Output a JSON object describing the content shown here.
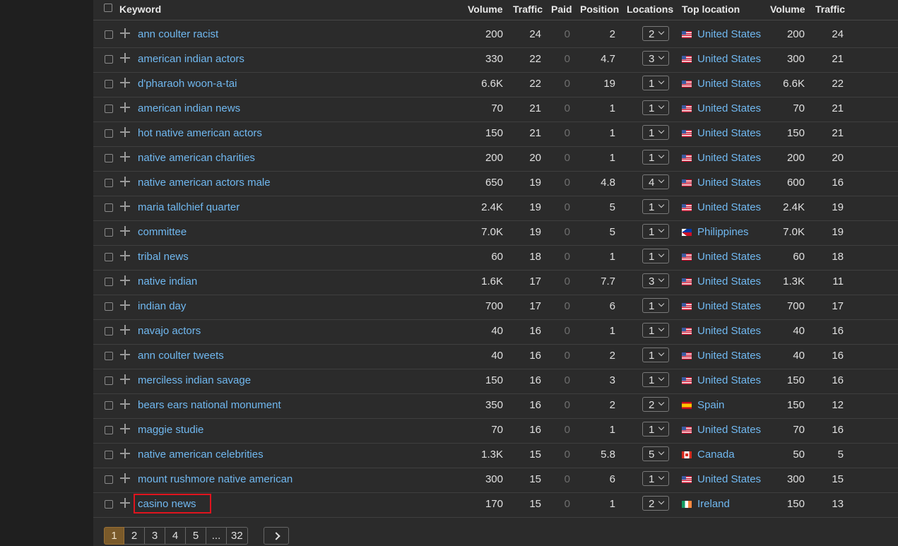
{
  "header": {
    "keyword": "Keyword",
    "volume": "Volume",
    "traffic": "Traffic",
    "paid": "Paid",
    "position": "Position",
    "locations": "Locations",
    "top_location": "Top location",
    "volume2": "Volume",
    "traffic2": "Traffic"
  },
  "rows": [
    {
      "keyword": "ann coulter racist",
      "volume": "200",
      "traffic": "24",
      "paid": "0",
      "position": "2",
      "locations": "2",
      "flag": "us",
      "country": "United States",
      "loc_volume": "200",
      "loc_traffic": "24"
    },
    {
      "keyword": "american indian actors",
      "volume": "330",
      "traffic": "22",
      "paid": "0",
      "position": "4.7",
      "locations": "3",
      "flag": "us",
      "country": "United States",
      "loc_volume": "300",
      "loc_traffic": "21"
    },
    {
      "keyword": "d'pharaoh woon-a-tai",
      "volume": "6.6K",
      "traffic": "22",
      "paid": "0",
      "position": "19",
      "locations": "1",
      "flag": "us",
      "country": "United States",
      "loc_volume": "6.6K",
      "loc_traffic": "22"
    },
    {
      "keyword": "american indian news",
      "volume": "70",
      "traffic": "21",
      "paid": "0",
      "position": "1",
      "locations": "1",
      "flag": "us",
      "country": "United States",
      "loc_volume": "70",
      "loc_traffic": "21"
    },
    {
      "keyword": "hot native american actors",
      "volume": "150",
      "traffic": "21",
      "paid": "0",
      "position": "1",
      "locations": "1",
      "flag": "us",
      "country": "United States",
      "loc_volume": "150",
      "loc_traffic": "21"
    },
    {
      "keyword": "native american charities",
      "volume": "200",
      "traffic": "20",
      "paid": "0",
      "position": "1",
      "locations": "1",
      "flag": "us",
      "country": "United States",
      "loc_volume": "200",
      "loc_traffic": "20"
    },
    {
      "keyword": "native american actors male",
      "volume": "650",
      "traffic": "19",
      "paid": "0",
      "position": "4.8",
      "locations": "4",
      "flag": "us",
      "country": "United States",
      "loc_volume": "600",
      "loc_traffic": "16"
    },
    {
      "keyword": "maria tallchief quarter",
      "volume": "2.4K",
      "traffic": "19",
      "paid": "0",
      "position": "5",
      "locations": "1",
      "flag": "us",
      "country": "United States",
      "loc_volume": "2.4K",
      "loc_traffic": "19"
    },
    {
      "keyword": "committee",
      "volume": "7.0K",
      "traffic": "19",
      "paid": "0",
      "position": "5",
      "locations": "1",
      "flag": "ph",
      "country": "Philippines",
      "loc_volume": "7.0K",
      "loc_traffic": "19"
    },
    {
      "keyword": "tribal news",
      "volume": "60",
      "traffic": "18",
      "paid": "0",
      "position": "1",
      "locations": "1",
      "flag": "us",
      "country": "United States",
      "loc_volume": "60",
      "loc_traffic": "18"
    },
    {
      "keyword": "native indian",
      "volume": "1.6K",
      "traffic": "17",
      "paid": "0",
      "position": "7.7",
      "locations": "3",
      "flag": "us",
      "country": "United States",
      "loc_volume": "1.3K",
      "loc_traffic": "11"
    },
    {
      "keyword": "indian day",
      "volume": "700",
      "traffic": "17",
      "paid": "0",
      "position": "6",
      "locations": "1",
      "flag": "us",
      "country": "United States",
      "loc_volume": "700",
      "loc_traffic": "17"
    },
    {
      "keyword": "navajo actors",
      "volume": "40",
      "traffic": "16",
      "paid": "0",
      "position": "1",
      "locations": "1",
      "flag": "us",
      "country": "United States",
      "loc_volume": "40",
      "loc_traffic": "16"
    },
    {
      "keyword": "ann coulter tweets",
      "volume": "40",
      "traffic": "16",
      "paid": "0",
      "position": "2",
      "locations": "1",
      "flag": "us",
      "country": "United States",
      "loc_volume": "40",
      "loc_traffic": "16"
    },
    {
      "keyword": "merciless indian savage",
      "volume": "150",
      "traffic": "16",
      "paid": "0",
      "position": "3",
      "locations": "1",
      "flag": "us",
      "country": "United States",
      "loc_volume": "150",
      "loc_traffic": "16"
    },
    {
      "keyword": "bears ears national monument",
      "volume": "350",
      "traffic": "16",
      "paid": "0",
      "position": "2",
      "locations": "2",
      "flag": "es",
      "country": "Spain",
      "loc_volume": "150",
      "loc_traffic": "12"
    },
    {
      "keyword": "maggie studie",
      "volume": "70",
      "traffic": "16",
      "paid": "0",
      "position": "1",
      "locations": "1",
      "flag": "us",
      "country": "United States",
      "loc_volume": "70",
      "loc_traffic": "16"
    },
    {
      "keyword": "native american celebrities",
      "volume": "1.3K",
      "traffic": "15",
      "paid": "0",
      "position": "5.8",
      "locations": "5",
      "flag": "ca",
      "country": "Canada",
      "loc_volume": "50",
      "loc_traffic": "5"
    },
    {
      "keyword": "mount rushmore native american",
      "volume": "300",
      "traffic": "15",
      "paid": "0",
      "position": "6",
      "locations": "1",
      "flag": "us",
      "country": "United States",
      "loc_volume": "300",
      "loc_traffic": "15"
    },
    {
      "keyword": "casino news",
      "volume": "170",
      "traffic": "15",
      "paid": "0",
      "position": "1",
      "locations": "2",
      "flag": "ie",
      "country": "Ireland",
      "loc_volume": "150",
      "loc_traffic": "13"
    }
  ],
  "pagination": {
    "pages": [
      "1",
      "2",
      "3",
      "4",
      "5",
      "...",
      "32"
    ],
    "active": "1"
  },
  "colors": {
    "link": "#70b8f0",
    "highlight_border": "#e0141e",
    "active_page": "#7a5a2a"
  }
}
